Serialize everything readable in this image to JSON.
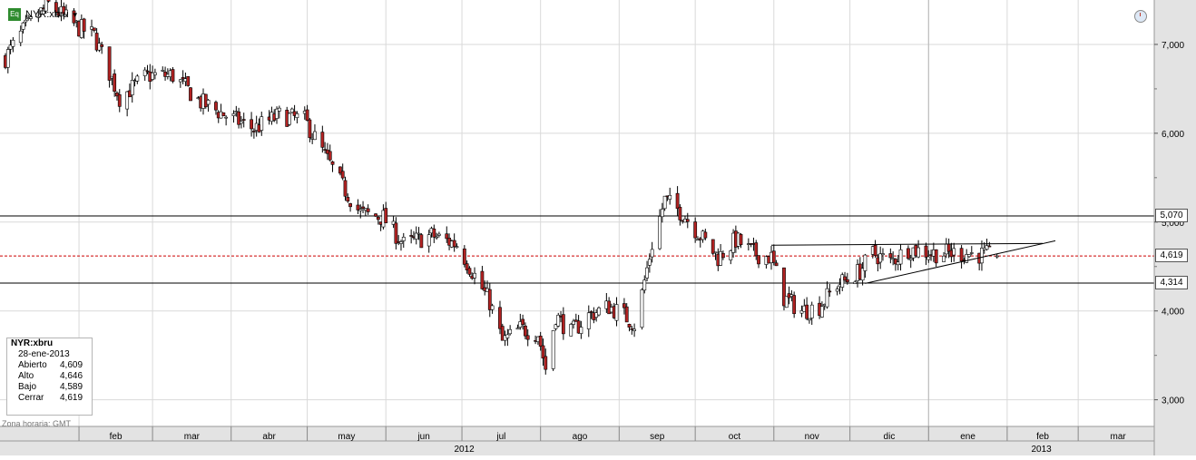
{
  "header": {
    "badge": "Eq",
    "symbol": "NYR:xbru"
  },
  "info_box": {
    "title": "NYR:xbru",
    "date": "28-ene-2013",
    "rows": [
      {
        "label": "Abierto",
        "value": "4,609"
      },
      {
        "label": "Alto",
        "value": "4,646"
      },
      {
        "label": "Bajo",
        "value": "4,589"
      },
      {
        "label": "Cerrar",
        "value": "4,619"
      }
    ]
  },
  "timezone_label": "Zona horaria: GMT",
  "colors": {
    "up": "#ffffff",
    "down": "#b22222",
    "wick": "#000000",
    "current_line": "#cc0000",
    "grid": "#d9d9d9",
    "panel": "#e3e3e3"
  },
  "icons": {
    "badge": "equity-icon",
    "clock": "clock-icon",
    "dropdown": "chevron-down-icon"
  },
  "chart_data": {
    "type": "candlestick",
    "title": "",
    "xlabel": "",
    "ylabel": "",
    "ylim": [
      2.7,
      7.5
    ],
    "y_ticks": [
      {
        "value": 3.0,
        "label": "3,000"
      },
      {
        "value": 4.0,
        "label": "4,000"
      },
      {
        "value": 5.0,
        "label": "5,000"
      },
      {
        "value": 6.0,
        "label": "6,000"
      },
      {
        "value": 7.0,
        "label": "7,000"
      }
    ],
    "x_range": [
      "2012-01-03",
      "2013-03-31"
    ],
    "month_ticks": [
      {
        "date": "2012-02-01",
        "label": "feb"
      },
      {
        "date": "2012-03-01",
        "label": "mar"
      },
      {
        "date": "2012-04-01",
        "label": "abr"
      },
      {
        "date": "2012-05-01",
        "label": "may"
      },
      {
        "date": "2012-06-01",
        "label": "jun"
      },
      {
        "date": "2012-07-01",
        "label": "jul"
      },
      {
        "date": "2012-08-01",
        "label": "ago"
      },
      {
        "date": "2012-09-01",
        "label": "sep"
      },
      {
        "date": "2012-10-01",
        "label": "oct"
      },
      {
        "date": "2012-11-01",
        "label": "nov"
      },
      {
        "date": "2012-12-01",
        "label": "dic"
      },
      {
        "date": "2013-01-01",
        "label": "ene"
      },
      {
        "date": "2013-02-01",
        "label": "feb"
      },
      {
        "date": "2013-03-01",
        "label": "mar"
      }
    ],
    "year_labels": [
      {
        "label": "2012"
      },
      {
        "label": "2013"
      }
    ],
    "year_divider_date": "2013-01-01",
    "horizontal_lines": [
      {
        "value": 5.07,
        "label": "5,070",
        "style": "solid"
      },
      {
        "value": 4.314,
        "label": "4,314",
        "style": "solid"
      },
      {
        "value": 4.619,
        "label": "4,619",
        "style": "dashed"
      }
    ],
    "trendlines": [
      {
        "from": [
          "2012-10-31",
          4.74
        ],
        "to": [
          "2013-02-15",
          4.76
        ]
      },
      {
        "from": [
          "2012-12-07",
          4.31
        ],
        "to": [
          "2013-02-20",
          4.79
        ]
      }
    ],
    "anchors": [
      [
        "2012-01-03",
        6.85
      ],
      [
        "2012-01-10",
        7.15
      ],
      [
        "2012-01-20",
        7.45
      ],
      [
        "2012-01-31",
        7.2
      ],
      [
        "2012-02-07",
        7.1
      ],
      [
        "2012-02-17",
        6.4
      ],
      [
        "2012-02-28",
        6.65
      ],
      [
        "2012-03-09",
        6.65
      ],
      [
        "2012-03-20",
        6.35
      ],
      [
        "2012-03-30",
        6.2
      ],
      [
        "2012-04-10",
        6.05
      ],
      [
        "2012-04-20",
        6.2
      ],
      [
        "2012-04-30",
        6.15
      ],
      [
        "2012-05-08",
        5.75
      ],
      [
        "2012-05-15",
        5.4
      ],
      [
        "2012-05-22",
        5.1
      ],
      [
        "2012-05-31",
        5.05
      ],
      [
        "2012-06-08",
        4.75
      ],
      [
        "2012-06-19",
        4.85
      ],
      [
        "2012-06-29",
        4.75
      ],
      [
        "2012-07-06",
        4.4
      ],
      [
        "2012-07-12",
        4.1
      ],
      [
        "2012-07-17",
        3.65
      ],
      [
        "2012-07-24",
        3.8
      ],
      [
        "2012-07-31",
        3.75
      ],
      [
        "2012-08-03",
        3.35
      ],
      [
        "2012-08-07",
        3.95
      ],
      [
        "2012-08-13",
        3.75
      ],
      [
        "2012-08-20",
        3.95
      ],
      [
        "2012-08-28",
        4.05
      ],
      [
        "2012-09-03",
        3.95
      ],
      [
        "2012-09-07",
        3.85
      ],
      [
        "2012-09-10",
        4.2
      ],
      [
        "2012-09-14",
        4.75
      ],
      [
        "2012-09-19",
        5.25
      ],
      [
        "2012-09-26",
        5.1
      ],
      [
        "2012-10-03",
        4.85
      ],
      [
        "2012-10-10",
        4.6
      ],
      [
        "2012-10-17",
        4.8
      ],
      [
        "2012-10-24",
        4.65
      ],
      [
        "2012-10-31",
        4.6
      ],
      [
        "2012-11-05",
        4.15
      ],
      [
        "2012-11-12",
        4.0
      ],
      [
        "2012-11-19",
        4.05
      ],
      [
        "2012-11-26",
        4.3
      ],
      [
        "2012-11-30",
        4.35
      ],
      [
        "2012-12-05",
        4.45
      ],
      [
        "2012-12-10",
        4.65
      ],
      [
        "2012-12-17",
        4.55
      ],
      [
        "2012-12-24",
        4.7
      ],
      [
        "2013-01-03",
        4.65
      ],
      [
        "2013-01-14",
        4.65
      ],
      [
        "2013-01-28",
        4.62
      ]
    ],
    "last": {
      "date": "2013-01-28",
      "open": 4.609,
      "high": 4.646,
      "low": 4.589,
      "close": 4.619
    }
  }
}
